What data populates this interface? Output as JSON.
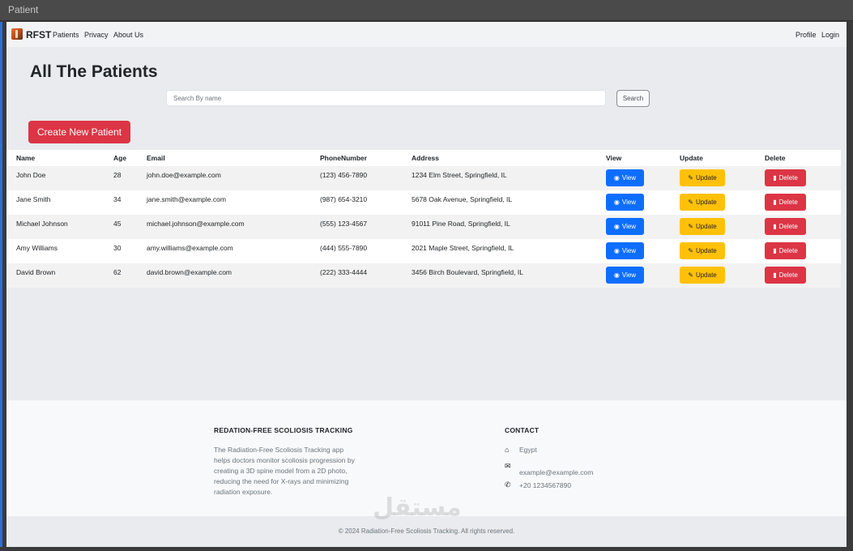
{
  "window": {
    "title": "Patient"
  },
  "nav": {
    "brand": "RFST",
    "links": [
      "Patients",
      "Privacy",
      "About Us"
    ],
    "right_links": [
      "Profile",
      "Login"
    ]
  },
  "page": {
    "title": "All The Patients",
    "search_placeholder": "Search By name",
    "search_button": "Search",
    "create_button": "Create New Patient"
  },
  "table": {
    "headers": [
      "Name",
      "Age",
      "Email",
      "PhoneNumber",
      "Address",
      "View",
      "Update",
      "Delete"
    ],
    "rows": [
      {
        "name": "John Doe",
        "age": "28",
        "email": "john.doe@example.com",
        "phone": "(123) 456-7890",
        "address": "1234 Elm Street, Springfield, IL"
      },
      {
        "name": "Jane Smith",
        "age": "34",
        "email": "jane.smith@example.com",
        "phone": "(987) 654-3210",
        "address": "5678 Oak Avenue, Springfield, IL"
      },
      {
        "name": "Michael Johnson",
        "age": "45",
        "email": "michael.johnson@example.com",
        "phone": "(555) 123-4567",
        "address": "91011 Pine Road, Springfield, IL"
      },
      {
        "name": "Amy Williams",
        "age": "30",
        "email": "amy.williams@example.com",
        "phone": "(444) 555-7890",
        "address": "2021 Maple Street, Springfield, IL"
      },
      {
        "name": "David Brown",
        "age": "62",
        "email": "david.brown@example.com",
        "phone": "(222) 333-4444",
        "address": "3456 Birch Boulevard, Springfield, IL"
      }
    ],
    "view_label": "View",
    "update_label": "Update",
    "delete_label": "Delete"
  },
  "footer": {
    "about_title": "REDATION-FREE SCOLIOSIS TRACKING",
    "about_text": "The Radiation-Free Scoliosis Tracking app helps doctors monitor scoliosis progression by creating a 3D spine model from a 2D photo, reducing the need for X-rays and minimizing radiation exposure.",
    "contact_title": "CONTACT",
    "location": "Egypt",
    "email": "example@example.com",
    "phone": "+20 1234567890",
    "copyright": "© 2024 Radiation-Free Scoliosis Tracking. All rights reserved."
  },
  "watermark": "مستقل",
  "colors": {
    "primary": "#0d6efd",
    "warning": "#ffc107",
    "danger": "#dc3545"
  }
}
